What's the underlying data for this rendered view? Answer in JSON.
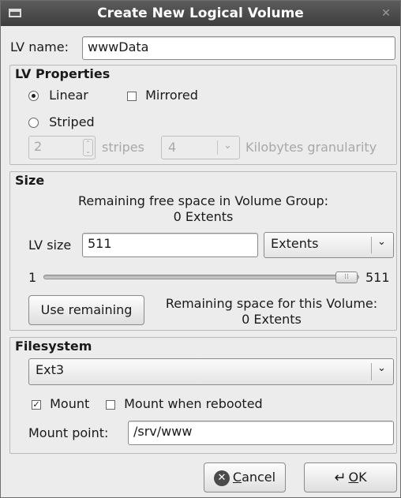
{
  "window": {
    "title": "Create New Logical Volume"
  },
  "lv_name": {
    "label": "LV name:",
    "value": "wwwData"
  },
  "lv_properties": {
    "title": "LV Properties",
    "linear_label": "Linear",
    "mirrored_label": "Mirrored",
    "striped_label": "Striped",
    "stripes_value": "2",
    "stripes_label": "stripes",
    "granularity_value": "4",
    "granularity_label": "Kilobytes granularity",
    "selected": "Linear",
    "mirrored_checked": false
  },
  "size": {
    "title": "Size",
    "remaining_vg_line1": "Remaining free space in Volume Group:",
    "remaining_vg_line2": "0 Extents",
    "lv_size_label": "LV size",
    "lv_size_value": "511",
    "unit_value": "Extents",
    "slider_min": "1",
    "slider_max": "511",
    "slider_value": 511,
    "use_remaining_label": "Use remaining",
    "remaining_vol_line1": "Remaining space for this Volume:",
    "remaining_vol_line2": "0 Extents"
  },
  "filesystem": {
    "title": "Filesystem",
    "type_value": "Ext3",
    "mount_label": "Mount",
    "mount_checked": true,
    "mount_reboot_label": "Mount when rebooted",
    "mount_reboot_checked": false,
    "mount_point_label": "Mount point:",
    "mount_point_value": "/srv/www"
  },
  "actions": {
    "cancel_mnemonic": "C",
    "cancel_rest": "ancel",
    "ok_mnemonic": "O",
    "ok_rest": "K"
  },
  "icons": {
    "cancel": "cancel-icon",
    "ok": "ok-icon",
    "menu": "window-menu-icon",
    "close": "close-icon"
  }
}
